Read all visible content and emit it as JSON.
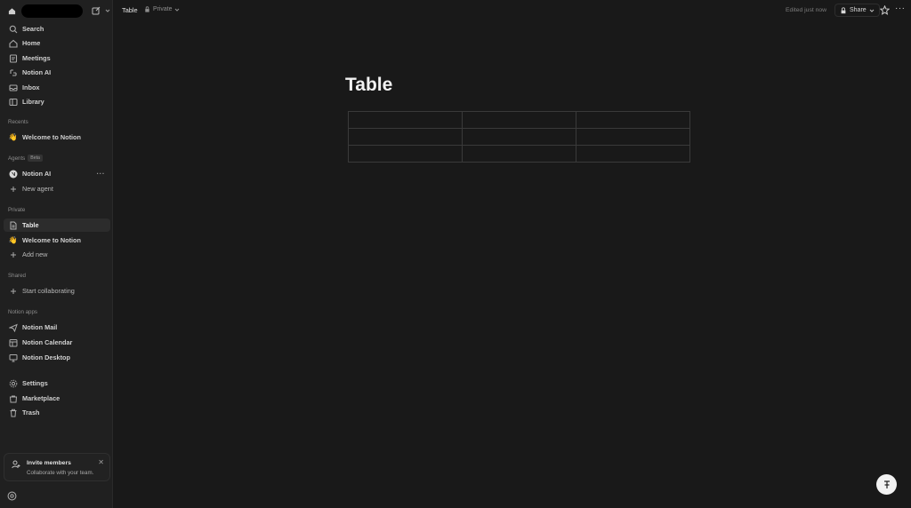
{
  "sidebar": {
    "top_items": [
      {
        "label": "Search",
        "icon": "search-icon"
      },
      {
        "label": "Home",
        "icon": "home-icon"
      },
      {
        "label": "Meetings",
        "icon": "meetings-icon"
      },
      {
        "label": "Notion AI",
        "icon": "notion-ai-icon"
      },
      {
        "label": "Inbox",
        "icon": "inbox-icon"
      },
      {
        "label": "Library",
        "icon": "library-icon"
      }
    ],
    "recents": {
      "title": "Recents",
      "items": [
        {
          "label": "Welcome to Notion",
          "emoji": "👋"
        }
      ]
    },
    "agents": {
      "title": "Agents",
      "badge": "Beta",
      "items": [
        {
          "label": "Notion AI"
        },
        {
          "label": "New agent"
        }
      ],
      "more": "···"
    },
    "private": {
      "title": "Private",
      "items": [
        {
          "label": "Table"
        },
        {
          "label": "Welcome to Notion",
          "emoji": "👋"
        },
        {
          "label": "Add new"
        }
      ]
    },
    "shared": {
      "title": "Shared",
      "items": [
        {
          "label": "Start collaborating"
        }
      ]
    },
    "apps": {
      "title": "Notion apps",
      "items": [
        {
          "label": "Notion Mail"
        },
        {
          "label": "Notion Calendar"
        },
        {
          "label": "Notion Desktop"
        }
      ]
    },
    "bottom_items": [
      {
        "label": "Settings"
      },
      {
        "label": "Marketplace"
      },
      {
        "label": "Trash"
      }
    ],
    "invite": {
      "title": "Invite members",
      "subtitle": "Collaborate with your team.",
      "close": "✕"
    }
  },
  "topbar": {
    "breadcrumb": "Table",
    "privacy": "Private",
    "edited": "Edited just now",
    "share": "Share"
  },
  "page": {
    "title": "Table",
    "table": {
      "rows": 3,
      "cols": 3
    }
  }
}
